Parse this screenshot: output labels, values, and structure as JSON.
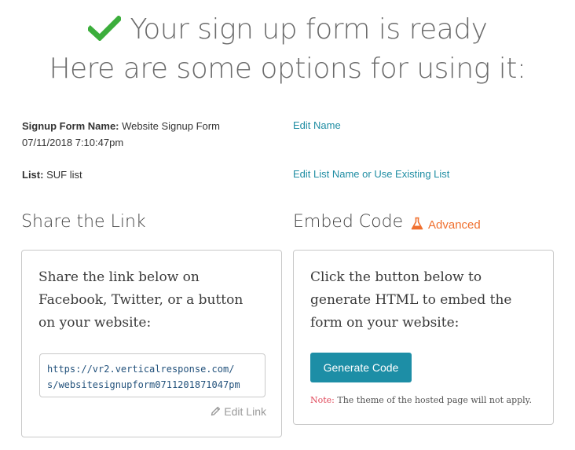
{
  "header": {
    "title": "Your sign up form is ready",
    "subtitle": "Here are some options for using it:",
    "check_icon_color": "#3cae3c"
  },
  "form_info": {
    "name_label": "Signup Form Name:",
    "name_value": "Website Signup Form",
    "date": "07/11/2018 7:10:47pm",
    "edit_name_link": "Edit Name",
    "list_label": "List:",
    "list_value": "SUF list",
    "edit_list_link": "Edit List Name or Use Existing List"
  },
  "share": {
    "title": "Share the Link",
    "description_lines": [
      "Share the link below on",
      "Facebook, Twitter, or a button",
      "on your website:"
    ],
    "url": "https://vr2.verticalresponse.com/\ns/websitesignupform0711201871047pm",
    "edit_link": "Edit Link"
  },
  "embed": {
    "title": "Embed Code",
    "advanced_label": "Advanced",
    "advanced_icon": "flask-icon",
    "description_lines": [
      "Click the button below to",
      "generate HTML to embed the",
      "form on your website:"
    ],
    "button_label": "Generate Code",
    "note_label": "Note:",
    "note_text": " The theme of the hosted page will not apply."
  },
  "colors": {
    "link": "#1f8da3",
    "button": "#1d8ea6",
    "advanced": "#f0702f",
    "note_label": "#e0485a"
  }
}
